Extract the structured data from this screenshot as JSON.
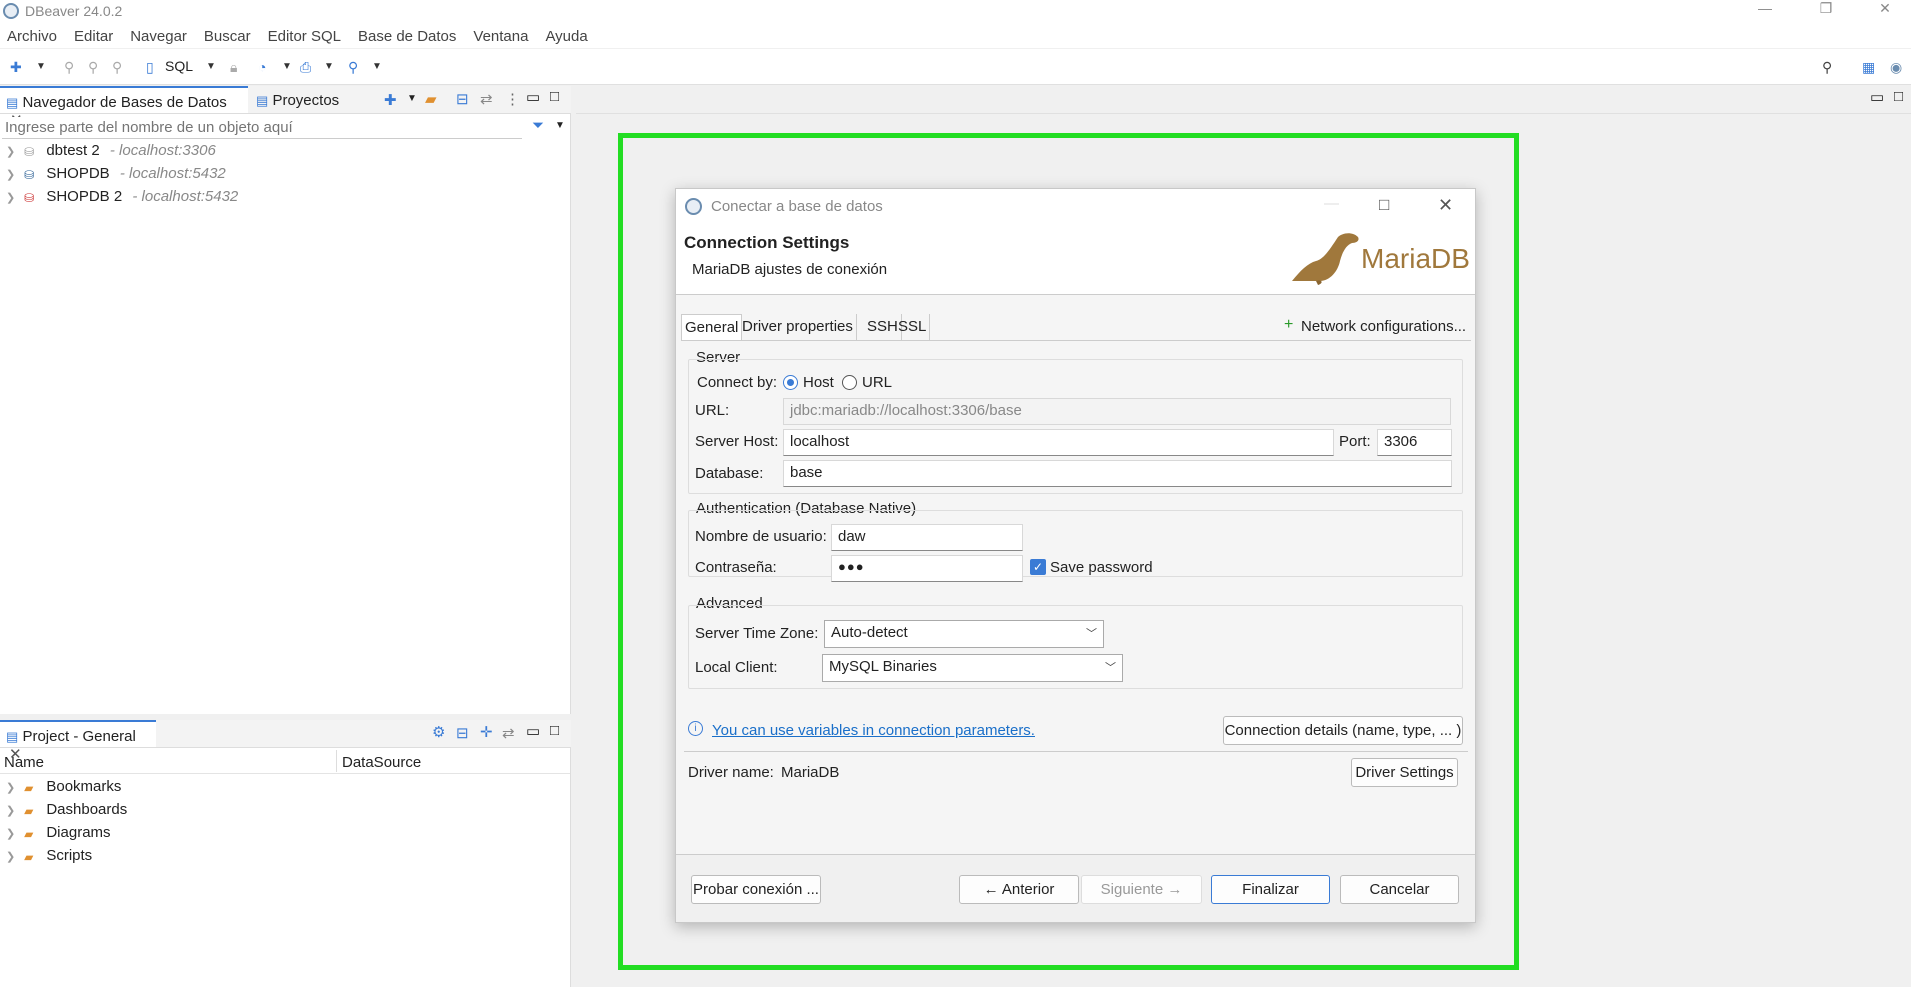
{
  "app": {
    "title": "DBeaver 24.0.2"
  },
  "menu": [
    "Archivo",
    "Editar",
    "Navegar",
    "Buscar",
    "Editor SQL",
    "Base de Datos",
    "Ventana",
    "Ayuda"
  ],
  "toolbar": {
    "sql_label": "SQL"
  },
  "navigator": {
    "tab_label": "Navegador de Bases de Datos",
    "projects_tab_label": "Proyectos",
    "filter_placeholder": "Ingrese parte del nombre de un objeto aquí",
    "items": [
      {
        "name": "dbtest 2",
        "host": "- localhost:3306",
        "icon": "mariadb-icon"
      },
      {
        "name": "SHOPDB",
        "host": "- localhost:5432",
        "icon": "postgres-icon"
      },
      {
        "name": "SHOPDB 2",
        "host": "- localhost:5432",
        "icon": "postgres-error-icon"
      }
    ]
  },
  "project": {
    "tab_label": "Project - General",
    "columns": [
      "Name",
      "DataSource"
    ],
    "items": [
      "Bookmarks",
      "Dashboards",
      "Diagrams",
      "Scripts"
    ]
  },
  "dialog": {
    "title": "Conectar a base de datos",
    "heading": "Connection Settings",
    "subheading": "MariaDB ajustes de conexión",
    "logo_text": "MariaDB",
    "tabs": [
      "General",
      "Driver properties",
      "SSH",
      "SSL"
    ],
    "network_config": "Network configurations...",
    "server_group": "Server",
    "connect_by_label": "Connect by:",
    "connect_options": [
      "Host",
      "URL"
    ],
    "connect_selected": "Host",
    "url_label": "URL:",
    "url_value": "jdbc:mariadb://localhost:3306/base",
    "host_label": "Server Host:",
    "host_value": "localhost",
    "port_label": "Port:",
    "port_value": "3306",
    "db_label": "Database:",
    "db_value": "base",
    "auth_group": "Authentication (Database Native)",
    "user_label": "Nombre de usuario:",
    "user_value": "daw",
    "pass_label": "Contraseña:",
    "pass_value": "●●●",
    "save_password": "Save password",
    "advanced_group": "Advanced",
    "tz_label": "Server Time Zone:",
    "tz_value": "Auto-detect",
    "client_label": "Local Client:",
    "client_value": "MySQL Binaries",
    "variables_link": "You can use variables in connection parameters.",
    "conn_details_btn": "Connection details (name, type, ... )",
    "driver_name_label": "Driver name:",
    "driver_name_value": "MariaDB",
    "driver_settings_btn": "Driver Settings",
    "test_btn": "Probar conexión ...",
    "back_btn": "← Anterior",
    "next_btn": "Siguiente →",
    "finish_btn": "Finalizar",
    "cancel_btn": "Cancelar"
  },
  "colors": {
    "accent": "#3a7bd5",
    "highlight_border": "#22dd22",
    "logo": "#a0783c"
  }
}
